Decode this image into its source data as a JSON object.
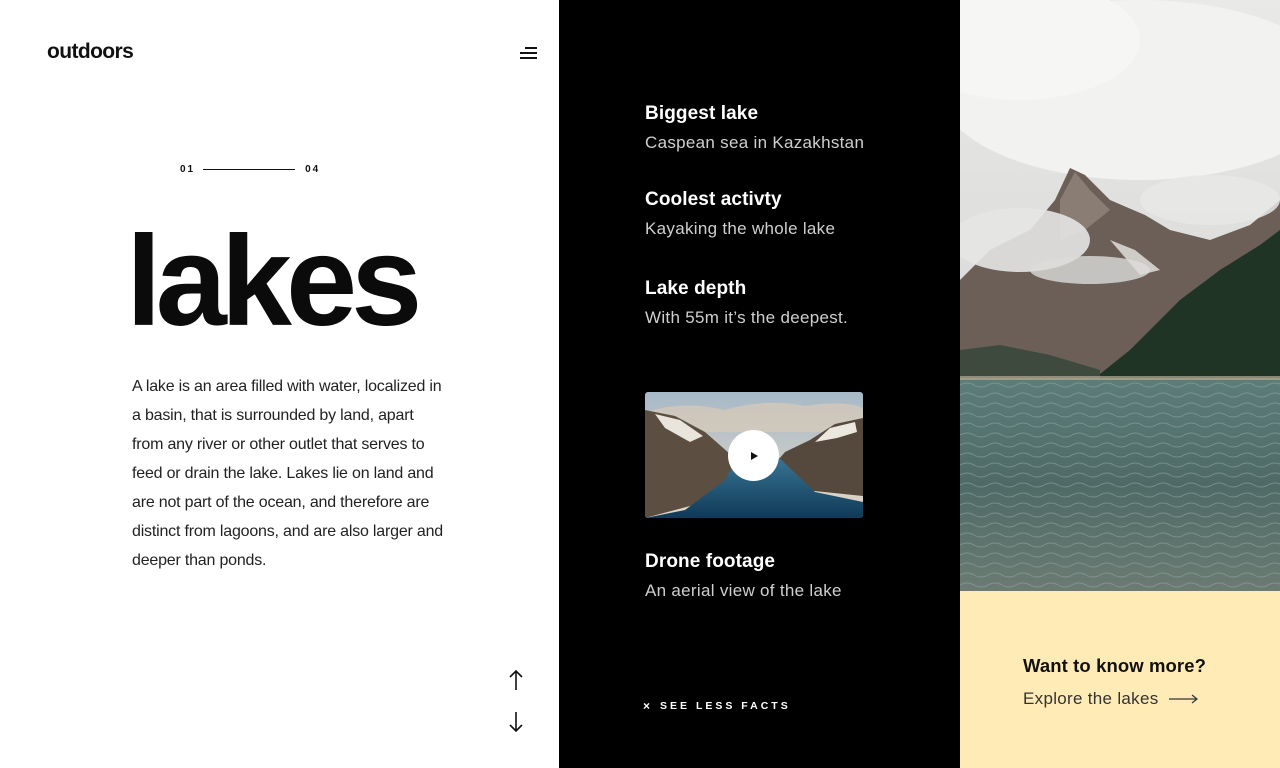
{
  "brand": {
    "logo": "outdoors"
  },
  "menu": {
    "icon": "hamburger-menu-icon"
  },
  "pager": {
    "current": "01",
    "total": "04"
  },
  "hero": {
    "title": "lakes",
    "description": "A lake is an area filled with water, localized in a basin, that is surrounded by land, apart from any river or other outlet that serves to feed or drain the lake. Lakes lie on land and are not part of the ocean, and therefore are distinct from lagoons, and are also larger and deeper than ponds."
  },
  "nav_arrows": {
    "up_icon": "arrow-up-icon",
    "down_icon": "arrow-down-icon"
  },
  "facts": [
    {
      "title": "Biggest lake",
      "subtitle": "Caspean sea in Kazakhstan"
    },
    {
      "title": "Coolest activty",
      "subtitle": "Kayaking the whole lake"
    },
    {
      "title": "Lake depth",
      "subtitle": "With 55m it’s the deepest."
    },
    {
      "title": "Drone footage",
      "subtitle": "An aerial view of the lake"
    }
  ],
  "video": {
    "play_icon": "play-icon"
  },
  "see_less": {
    "icon": "×",
    "label": "SEE LESS FACTS"
  },
  "cta": {
    "question": "Want to know more?",
    "link": "Explore the lakes"
  },
  "colors": {
    "accent_panel": "#feebb6",
    "dark_panel": "#000000",
    "text": "#111111"
  }
}
